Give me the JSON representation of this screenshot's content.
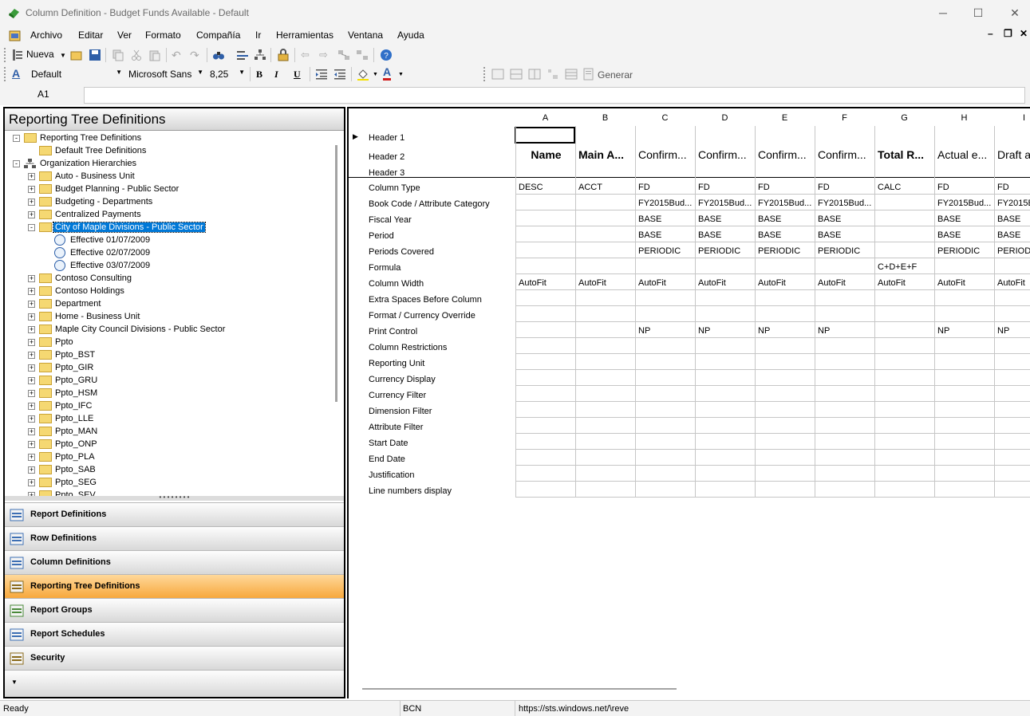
{
  "window": {
    "title": "Column Definition - Budget Funds Available - Default"
  },
  "menu": [
    "Archivo",
    "Editar",
    "Ver",
    "Formato",
    "Compañía",
    "Ir",
    "Herramientas",
    "Ventana",
    "Ayuda"
  ],
  "toolbar": {
    "new_label": "Nueva",
    "style_value": "Default",
    "font_value": "Microsoft Sans",
    "size_value": "8,25",
    "generate_label": "Generar",
    "bold": "B",
    "italic": "I",
    "underline": "U",
    "style_glyph": "A",
    "color_glyph": "A"
  },
  "formula_bar": {
    "cell_ref": "A1",
    "value": ""
  },
  "left_panel": {
    "title": "Reporting Tree Definitions",
    "tree": [
      "Reporting Tree Definitions",
      "Default Tree Definitions",
      "Organization Hierarchies",
      "Auto - Business Unit",
      "Budget Planning - Public Sector",
      "Budgeting - Departments",
      "Centralized Payments",
      "City of Maple Divisions - Public Sector",
      "Effective 01/07/2009",
      "Effective 02/07/2009",
      "Effective 03/07/2009",
      "Contoso Consulting",
      "Contoso Holdings",
      "Department",
      "Home - Business Unit",
      "Maple City Council Divisions - Public Sector",
      "Ppto",
      "Ppto_BST",
      "Ppto_GIR",
      "Ppto_GRU",
      "Ppto_HSM",
      "Ppto_IFC",
      "Ppto_LLE",
      "Ppto_MAN",
      "Ppto_ONP",
      "Ppto_PLA",
      "Ppto_SAB",
      "Ppto_SEG",
      "Ppto_SEV"
    ],
    "nav": [
      "Report Definitions",
      "Row Definitions",
      "Column Definitions",
      "Reporting Tree Definitions",
      "Report Groups",
      "Report Schedules",
      "Security"
    ]
  },
  "grid": {
    "columns": [
      "A",
      "B",
      "C",
      "D",
      "E",
      "F",
      "G",
      "H",
      "I"
    ],
    "header_rows": [
      "Header 1",
      "Header 2",
      "Header 3"
    ],
    "header2": [
      "Name",
      "Main A...",
      "Confirm...",
      "Confirm...",
      "Confirm...",
      "Confirm...",
      "Total R...",
      "Actual e...",
      "Draft a"
    ],
    "rows": [
      {
        "label": "Column Type",
        "cells": [
          "DESC",
          "ACCT",
          "FD",
          "FD",
          "FD",
          "FD",
          "CALC",
          "FD",
          "FD"
        ]
      },
      {
        "label": "Book Code / Attribute Category",
        "cells": [
          "",
          "",
          "FY2015Bud...",
          "FY2015Bud...",
          "FY2015Bud...",
          "FY2015Bud...",
          "",
          "FY2015Bud...",
          "FY2015B"
        ]
      },
      {
        "label": "Fiscal Year",
        "cells": [
          "",
          "",
          "BASE",
          "BASE",
          "BASE",
          "BASE",
          "",
          "BASE",
          "BASE"
        ]
      },
      {
        "label": "Period",
        "cells": [
          "",
          "",
          "BASE",
          "BASE",
          "BASE",
          "BASE",
          "",
          "BASE",
          "BASE"
        ]
      },
      {
        "label": "Periods Covered",
        "cells": [
          "",
          "",
          "PERIODIC",
          "PERIODIC",
          "PERIODIC",
          "PERIODIC",
          "",
          "PERIODIC",
          "PERIODI"
        ]
      },
      {
        "label": "Formula",
        "cells": [
          "",
          "",
          "",
          "",
          "",
          "",
          "C+D+E+F",
          "",
          ""
        ]
      },
      {
        "label": "Column Width",
        "cells": [
          "AutoFit",
          "AutoFit",
          "AutoFit",
          "AutoFit",
          "AutoFit",
          "AutoFit",
          "AutoFit",
          "AutoFit",
          "AutoFit"
        ]
      },
      {
        "label": "Extra Spaces Before Column",
        "cells": [
          "",
          "",
          "",
          "",
          "",
          "",
          "",
          "",
          ""
        ]
      },
      {
        "label": "Format / Currency Override",
        "cells": [
          "",
          "",
          "",
          "",
          "",
          "",
          "",
          "",
          ""
        ]
      },
      {
        "label": "Print Control",
        "cells": [
          "",
          "",
          "NP",
          "NP",
          "NP",
          "NP",
          "",
          "NP",
          "NP"
        ]
      },
      {
        "label": "Column Restrictions",
        "cells": [
          "",
          "",
          "",
          "",
          "",
          "",
          "",
          "",
          ""
        ]
      },
      {
        "label": "Reporting Unit",
        "cells": [
          "",
          "",
          "",
          "",
          "",
          "",
          "",
          "",
          ""
        ]
      },
      {
        "label": "Currency Display",
        "cells": [
          "",
          "",
          "",
          "",
          "",
          "",
          "",
          "",
          ""
        ]
      },
      {
        "label": "Currency Filter",
        "cells": [
          "",
          "",
          "",
          "",
          "",
          "",
          "",
          "",
          ""
        ]
      },
      {
        "label": "Dimension Filter",
        "cells": [
          "",
          "",
          "",
          "",
          "",
          "",
          "",
          "",
          ""
        ]
      },
      {
        "label": "Attribute Filter",
        "cells": [
          "",
          "",
          "",
          "",
          "",
          "",
          "",
          "",
          ""
        ]
      },
      {
        "label": "Start Date",
        "cells": [
          "",
          "",
          "",
          "",
          "",
          "",
          "",
          "",
          ""
        ]
      },
      {
        "label": "End Date",
        "cells": [
          "",
          "",
          "",
          "",
          "",
          "",
          "",
          "",
          ""
        ]
      },
      {
        "label": "Justification",
        "cells": [
          "",
          "",
          "",
          "",
          "",
          "",
          "",
          "",
          ""
        ]
      },
      {
        "label": "Line numbers display",
        "cells": [
          "",
          "",
          "",
          "",
          "",
          "",
          "",
          "",
          ""
        ]
      }
    ]
  },
  "status": {
    "left": "Ready",
    "company": "BCN",
    "url": "https://sts.windows.net/\\reve"
  }
}
